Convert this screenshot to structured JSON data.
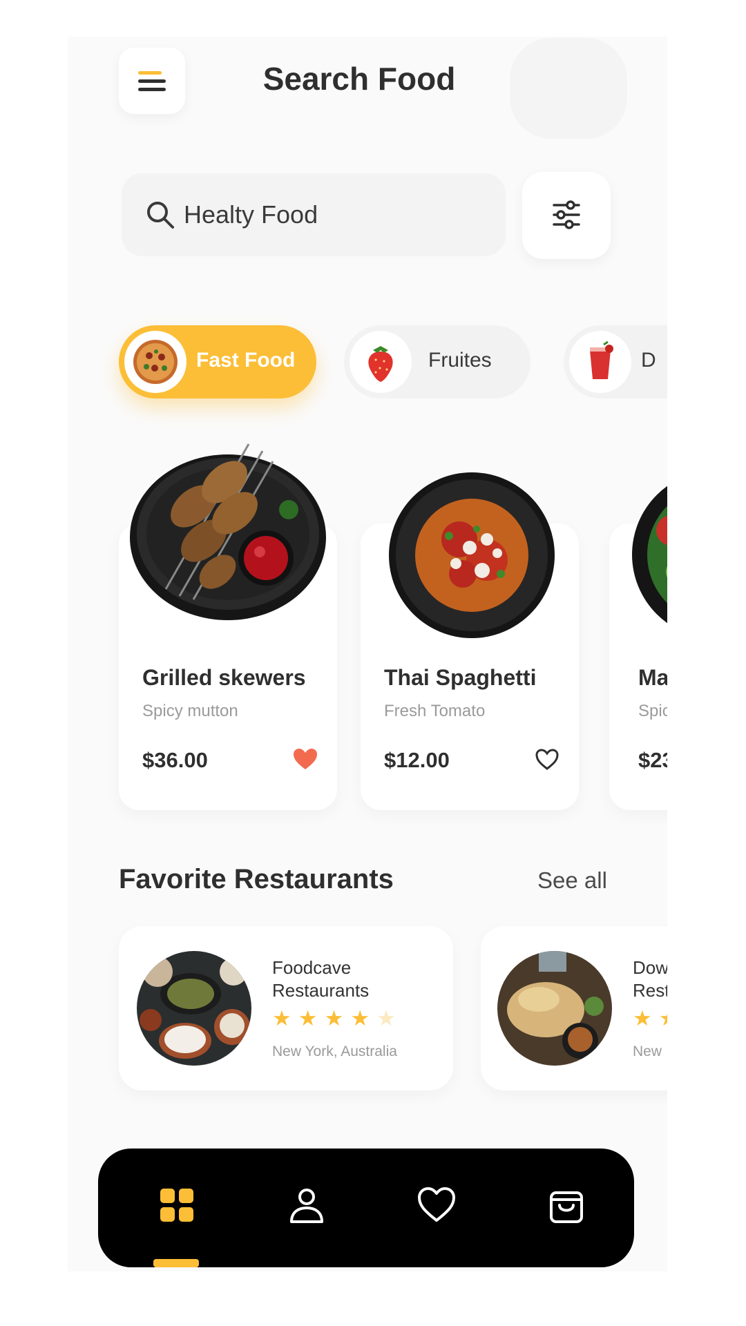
{
  "header": {
    "title": "Search Food",
    "menu_icon": "hamburger-menu-icon"
  },
  "search": {
    "value": "Healty Food",
    "icon": "search-icon",
    "filter_icon": "sliders-icon"
  },
  "categories": [
    {
      "label": "Fast Food",
      "active": true,
      "icon": "pizza-icon"
    },
    {
      "label": "Fruites",
      "active": false,
      "icon": "strawberry-icon"
    },
    {
      "label": "D",
      "active": false,
      "icon": "drink-icon"
    }
  ],
  "foods": [
    {
      "name": "Grilled skewers",
      "desc": "Spicy mutton",
      "price": "$36.00",
      "favorited": true
    },
    {
      "name": "Thai Spaghetti",
      "desc": "Fresh Tomato",
      "price": "$12.00",
      "favorited": false
    },
    {
      "name": "Ma",
      "desc": "Spic",
      "price": "$23",
      "favorited": false
    }
  ],
  "favorites_section": {
    "title": "Favorite Restaurants",
    "see_all": "See all"
  },
  "restaurants": [
    {
      "name_line1": "Foodcave",
      "name_line2": "Restaurants",
      "rating": 4,
      "stars": "★★★★",
      "stars_dim": "★",
      "location": "New York, Australia"
    },
    {
      "name_line1": "Dow",
      "name_line2": "Rest",
      "stars": "★★",
      "stars_dim": "",
      "location": "New"
    }
  ],
  "bottom_nav": {
    "items": [
      "home-grid-icon",
      "profile-icon",
      "heart-icon",
      "shopping-bag-icon"
    ],
    "active_index": 0
  },
  "colors": {
    "accent": "#fbbe36",
    "heart_active": "#f26b4f",
    "background": "#fafafa",
    "nav_background": "#000000"
  }
}
